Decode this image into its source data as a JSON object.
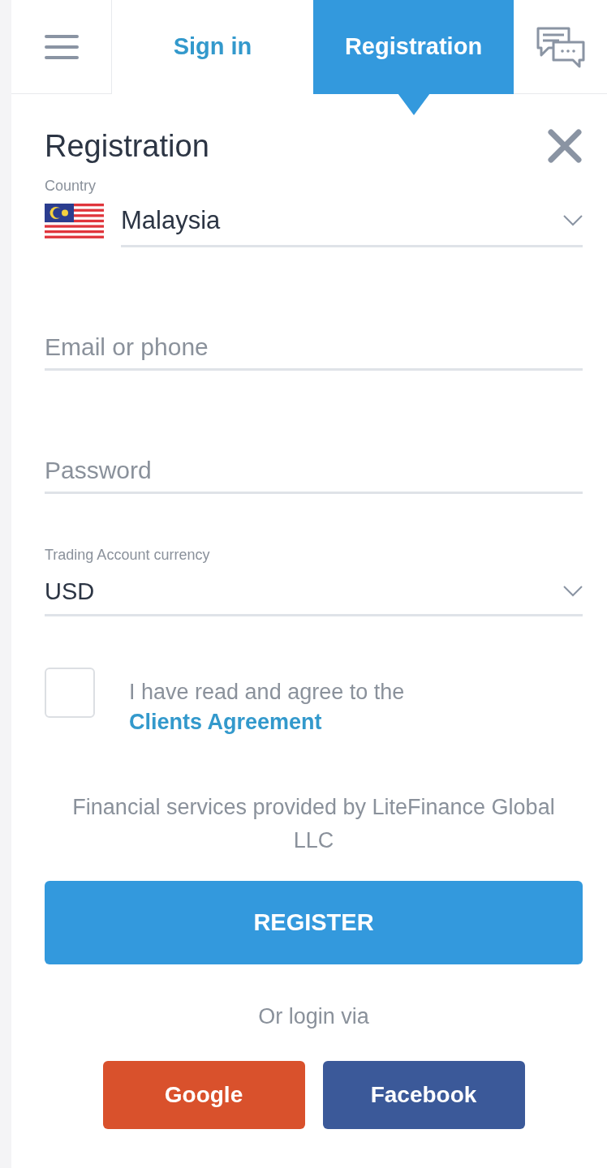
{
  "tabs": [
    {
      "label": "Sign in",
      "selected": false
    },
    {
      "label": "Registration",
      "selected": true
    }
  ],
  "form": {
    "title": "Registration",
    "country": {
      "label": "Country",
      "value": "Malaysia"
    },
    "email": {
      "placeholder": "Email or phone"
    },
    "password": {
      "placeholder": "Password"
    },
    "currency": {
      "label": "Trading Account currency",
      "value": "USD"
    },
    "agreement": {
      "checked": false,
      "text": "I have read and agree to the ",
      "link": "Clients Agreement"
    },
    "disclaimer": "Financial services provided by LiteFinance Global LLC",
    "register_button": "REGISTER",
    "social_label": "Or login via",
    "social_buttons": [
      {
        "label": "Google",
        "color": "#d9512c"
      },
      {
        "label": "Facebook",
        "color": "#3b5999"
      }
    ]
  }
}
